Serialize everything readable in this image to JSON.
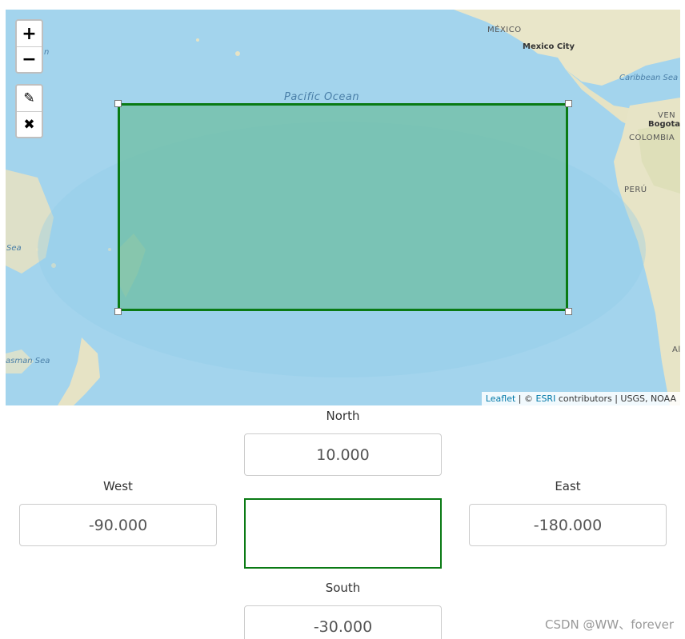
{
  "map": {
    "zoom_in_label": "+",
    "zoom_out_label": "−",
    "edit_label": "✎",
    "delete_label": "✖",
    "labels": {
      "mexico": "MÉXICO",
      "mexico_city": "Mexico City",
      "caribbean_sea": "Caribbean Sea",
      "pacific_ocean": "Pacific Ocean",
      "bogota": "Bogota",
      "colombia": "COLOMBIA",
      "ven": "VEN",
      "peru": "PERÚ",
      "sea": "Sea",
      "tasman_sea": "asman Sea",
      "al": "Al",
      "left_n": "n"
    },
    "attribution": {
      "leaflet": "Leaflet",
      "sep1": " | © ",
      "esri": "ESRI",
      "rest": " contributors | USGS, NOAA"
    }
  },
  "bbox": {
    "north_label": "North",
    "north_value": "10.000",
    "west_label": "West",
    "west_value": "-90.000",
    "east_label": "East",
    "east_value": "-180.000",
    "south_label": "South",
    "south_value": "-30.000"
  },
  "watermark": "CSDN @WW、forever",
  "colors": {
    "ocean": "#a8d8ef",
    "land": "#e8e4c8",
    "bbox_stroke": "#0a7a14",
    "bbox_fill": "#6ebea0"
  }
}
